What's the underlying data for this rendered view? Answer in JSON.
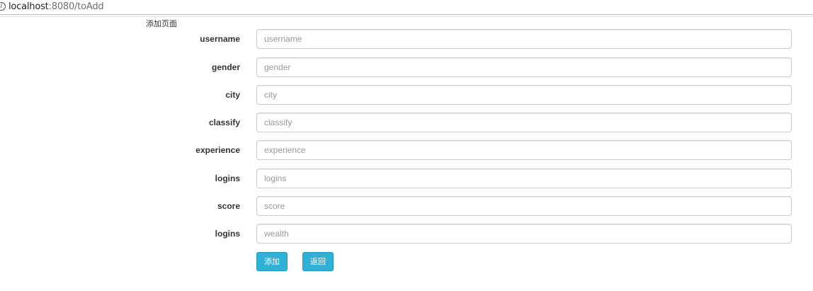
{
  "browser": {
    "url_host": "localhost",
    "url_rest": ":8080/toAdd",
    "info_icon": "info-icon"
  },
  "page": {
    "title": "添加页面"
  },
  "form": {
    "fields": [
      {
        "label": "username",
        "placeholder": "username",
        "value": ""
      },
      {
        "label": "gender",
        "placeholder": "gender",
        "value": ""
      },
      {
        "label": "city",
        "placeholder": "city",
        "value": ""
      },
      {
        "label": "classify",
        "placeholder": "classify",
        "value": ""
      },
      {
        "label": "experience",
        "placeholder": "experience",
        "value": ""
      },
      {
        "label": "logins",
        "placeholder": "logins",
        "value": ""
      },
      {
        "label": "score",
        "placeholder": "score",
        "value": ""
      },
      {
        "label": "logins",
        "placeholder": "wealth",
        "value": ""
      }
    ],
    "add_label": "添加",
    "back_label": "返回"
  },
  "colors": {
    "button_bg": "#31b0d5",
    "button_border": "#269abc",
    "input_border": "#cccccc"
  }
}
